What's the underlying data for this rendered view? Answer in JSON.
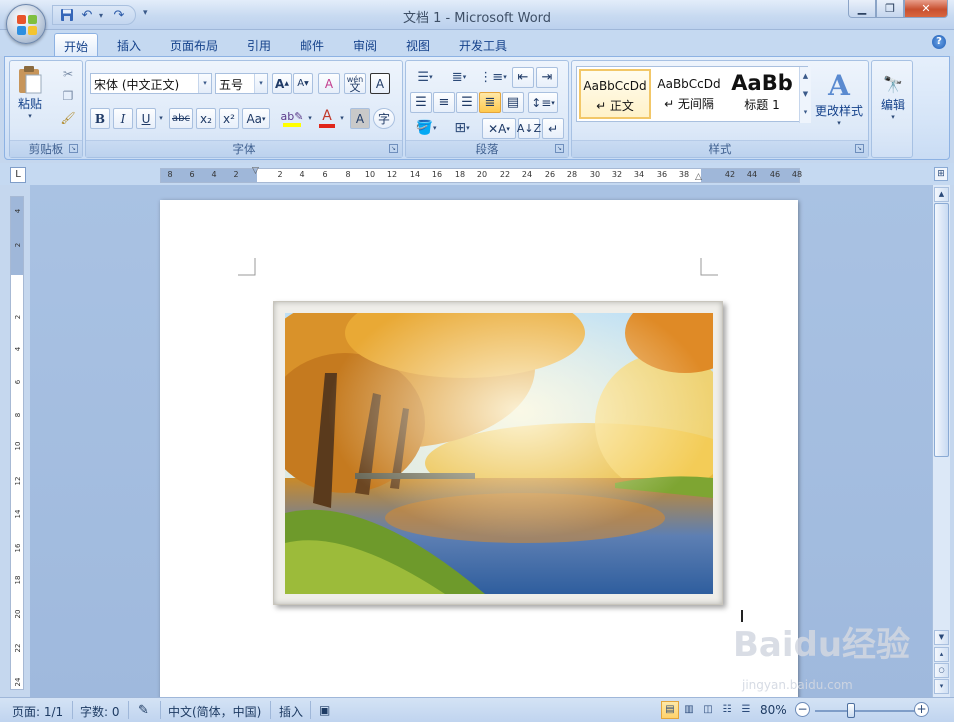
{
  "window": {
    "title": "文档 1 - Microsoft Word"
  },
  "tabs": [
    {
      "label": "开始",
      "active": true
    },
    {
      "label": "插入"
    },
    {
      "label": "页面布局"
    },
    {
      "label": "引用"
    },
    {
      "label": "邮件"
    },
    {
      "label": "审阅"
    },
    {
      "label": "视图"
    },
    {
      "label": "开发工具"
    }
  ],
  "ribbon": {
    "clipboard": {
      "label": "剪贴板",
      "paste": "粘贴"
    },
    "font": {
      "label": "字体",
      "font_name": "宋体 (中文正文)",
      "font_size": "五号",
      "bold": "B",
      "italic": "I",
      "underline": "U",
      "strike": "abc",
      "subscript": "x₂",
      "superscript": "x²",
      "change_case": "Aa",
      "grow": "A",
      "shrink": "A",
      "clear": "A",
      "phonetic": "wén",
      "phonetic2": "文",
      "border_char": "A",
      "shade_char": "A",
      "enclose": "字"
    },
    "paragraph": {
      "label": "段落"
    },
    "styles": {
      "label": "样式",
      "items": [
        {
          "preview": "AaBbCcDd",
          "name": "↵ 正文"
        },
        {
          "preview": "AaBbCcDd",
          "name": "↵ 无间隔"
        },
        {
          "preview": "AaBb",
          "name": "标题 1"
        }
      ],
      "change_styles": "更改样式"
    },
    "editing": {
      "label": "编辑"
    }
  },
  "ruler": {
    "h_ticks": [
      "8",
      "6",
      "4",
      "2",
      "2",
      "4",
      "6",
      "8",
      "10",
      "12",
      "14",
      "16",
      "18",
      "20",
      "22",
      "24",
      "26",
      "28",
      "30",
      "32",
      "34",
      "36",
      "38",
      "42",
      "44",
      "46",
      "48"
    ],
    "v_ticks": [
      "4",
      "2",
      "2",
      "4",
      "6",
      "8",
      "10",
      "12",
      "14",
      "16",
      "18",
      "20",
      "22",
      "24"
    ]
  },
  "statusbar": {
    "page": "页面: 1/1",
    "words": "字数: 0",
    "language": "中文(简体，中国)",
    "mode": "插入",
    "zoom": "80%"
  },
  "watermark": {
    "text": "Baidu经验",
    "sub": "jingyan.baidu.com"
  }
}
